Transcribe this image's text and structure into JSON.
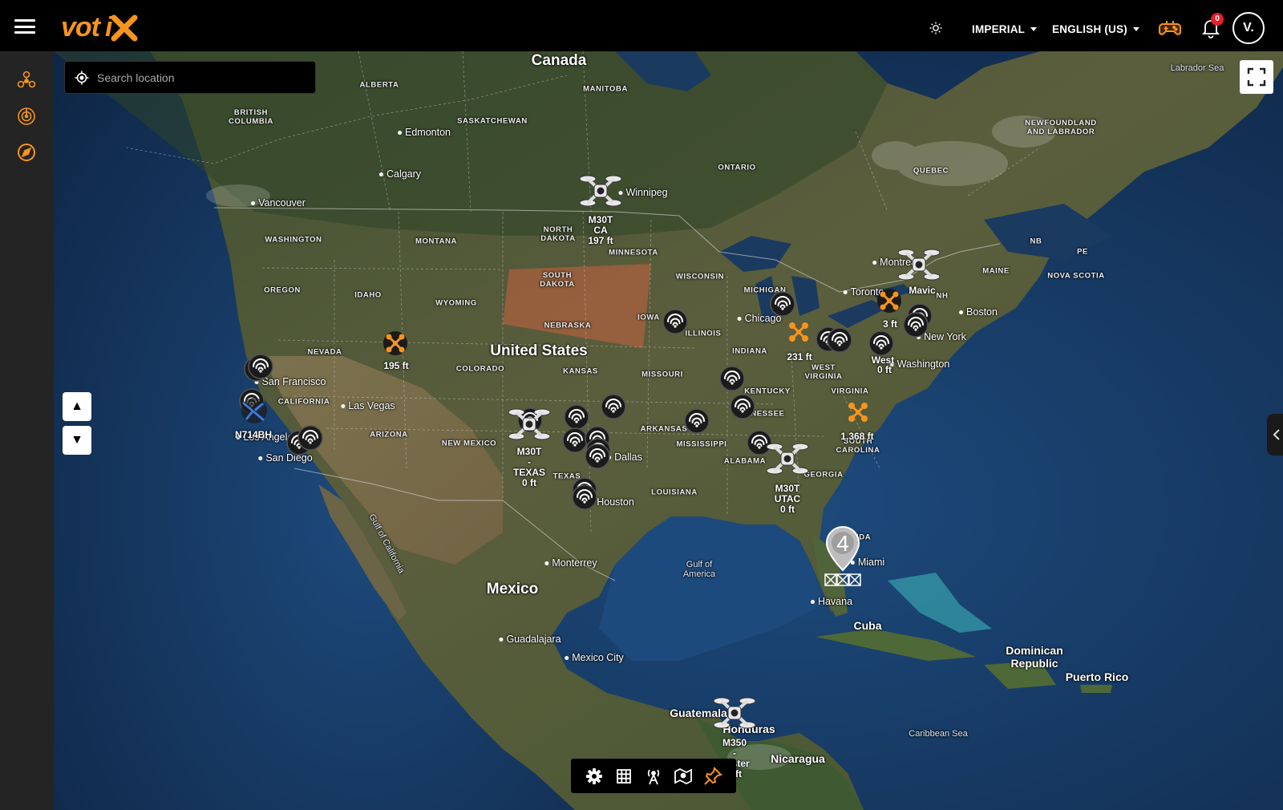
{
  "app": {
    "logo_text": "VOTIX"
  },
  "header": {
    "units_label": "IMPERIAL",
    "language_label": "ENGLISH (US)",
    "notifications_count": "0",
    "avatar_initial": "V."
  },
  "search": {
    "placeholder": "Search location"
  },
  "map_labels": {
    "countries": [
      "Canada",
      "United States",
      "Mexico"
    ],
    "states": [
      "ALBERTA",
      "MANITOBA",
      "SASKATCHEWAN",
      "BRITISH COLUMBIA",
      "ONTARIO",
      "QUEBEC",
      "NEWFOUNDLAND AND LABRADOR",
      "NORTH DAKOTA",
      "SOUTH DAKOTA",
      "MINNESOTA",
      "WASHINGTON",
      "MONTANA",
      "OREGON",
      "IDAHO",
      "WYOMING",
      "NEBRASKA",
      "IOWA",
      "WISCONSIN",
      "MICHIGAN",
      "ILLINOIS",
      "INDIANA",
      "NEVADA",
      "COLORADO",
      "KANSAS",
      "MISSOURI",
      "KENTUCKY",
      "WEST VIRGINIA",
      "VIRGINIA",
      "ARIZONA",
      "NEW MEXICO",
      "ARKANSAS",
      "MISSISSIPPI",
      "ALABAMA",
      "TEXAS",
      "LOUISIANA",
      "MAINE",
      "NB",
      "PE",
      "NOVA SCOTIA",
      "NH",
      "FLORIDA",
      "SOUTH CAROLINA",
      "CALIFORNIA",
      "TENNESSEE",
      "GEORGIA"
    ],
    "cities": [
      "Edmonton",
      "Calgary",
      "Vancouver",
      "Winnipeg",
      "Montreal",
      "Toronto",
      "Chicago",
      "Boston",
      "New York",
      "Washington",
      "San Francisco",
      "Las Vegas",
      "Los Angeles",
      "San Diego",
      "Dallas",
      "Houston",
      "Monterrey",
      "Guadalajara",
      "Mexico City",
      "Miami",
      "Havana"
    ],
    "water": [
      "Labrador Sea",
      "Gulf of America",
      "Gulf of California",
      "Caribbean Sea"
    ],
    "islands": [
      "Cuba",
      "Dominican Republic",
      "Puerto Rico",
      "Guatemala",
      "Honduras",
      "Nicaragua"
    ]
  },
  "markers": {
    "drones": [
      {
        "model": "M30T",
        "name": "CA",
        "altitude": "197 ft"
      },
      {
        "model": "M30T",
        "name": "TEXAS",
        "altitude": "0 ft"
      },
      {
        "model": "M30T",
        "name": "UTAC",
        "altitude": "0 ft"
      },
      {
        "model": "M350",
        "name": "Alister",
        "altitude": "0 ft"
      },
      {
        "model": "Mavic",
        "name": "",
        "altitude": ""
      }
    ],
    "altitude_tags": [
      "195 ft",
      "231 ft",
      "1,368 ft",
      "3 ft",
      "West",
      "0 ft"
    ],
    "aircraft_callsign": "N714BH",
    "cluster_count": "4"
  },
  "colors": {
    "accent": "#f7941d",
    "topbar_bg": "#000000",
    "sidebar_bg": "#242424",
    "ocean": "#16355f",
    "land": "#4c5a36",
    "highlight_region": "#c06040",
    "badge": "#e8202a"
  },
  "icons": {
    "menu": "hamburger-icon",
    "theme": "sun-icon",
    "controller": "gamepad-icon",
    "notifications": "bell-icon",
    "sidebar": [
      "drones-icon",
      "radar-icon",
      "compass-icon"
    ],
    "toolbar": [
      "gear-icon",
      "grid-icon",
      "antenna-icon",
      "map-icon",
      "pin-icon"
    ],
    "zoom_up": "▲",
    "zoom_down": "▼"
  }
}
